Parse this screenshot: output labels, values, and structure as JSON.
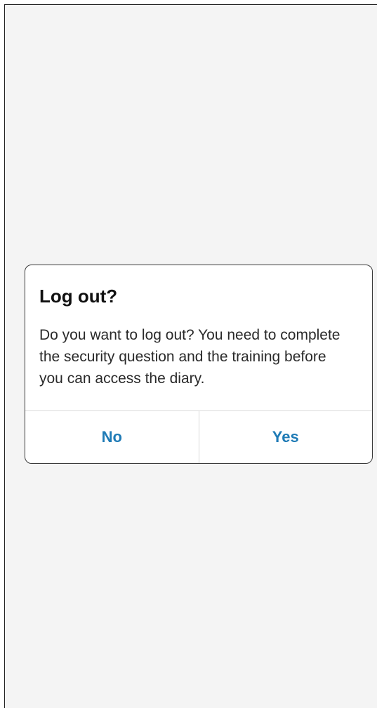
{
  "dialog": {
    "title": "Log out?",
    "message": "Do you want to log out? You need to complete the security question and the training before you can access the diary.",
    "buttons": {
      "no_label": "No",
      "yes_label": "Yes"
    }
  },
  "colors": {
    "background": "#f4f4f4",
    "dialog_background": "#ffffff",
    "accent": "#1f7bb6",
    "title_text": "#111111",
    "body_text": "#2a2a2a"
  }
}
